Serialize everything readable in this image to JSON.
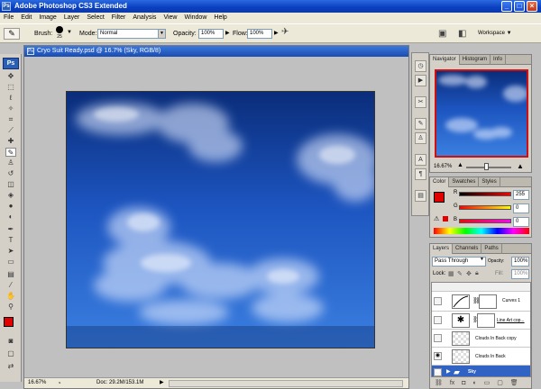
{
  "app": {
    "title": "Adobe Photoshop CS3 Extended",
    "logo": "Ps",
    "window_controls": {
      "minimize": "_",
      "maximize": "□",
      "close": "×"
    }
  },
  "menu": [
    "File",
    "Edit",
    "Image",
    "Layer",
    "Select",
    "Filter",
    "Analysis",
    "View",
    "Window",
    "Help"
  ],
  "options_bar": {
    "brush_label": "Brush:",
    "brush_size": "25",
    "mode_label": "Mode:",
    "mode_value": "Normal",
    "opacity_label": "Opacity:",
    "opacity_value": "100%",
    "flow_label": "Flow:",
    "flow_value": "100%",
    "workspace_label": "Workspace ▼"
  },
  "document": {
    "title": "Cryo Suit Ready.psd @ 16.7% (Sky, RGB/8)",
    "zoom": "16.67%",
    "doc_info": "Doc: 29.2M/153.1M"
  },
  "navigator": {
    "tabs": [
      "Navigator",
      "Histogram",
      "Info"
    ],
    "zoom": "16.67%"
  },
  "color_panel": {
    "tabs": [
      "Color",
      "Swatches",
      "Styles"
    ],
    "fg_color": "#e00000",
    "bg_color": "#000000",
    "channels": [
      {
        "label": "R",
        "value": "255"
      },
      {
        "label": "G",
        "value": "0"
      },
      {
        "label": "B",
        "value": "0"
      }
    ]
  },
  "layers_panel": {
    "tabs": [
      "Layers",
      "Channels",
      "Paths"
    ],
    "blend_mode": "Pass Through",
    "opacity_label": "Opacity:",
    "opacity_value": "100%",
    "lock_label": "Lock:",
    "fill_label": "Fill:",
    "fill_value": "100%",
    "layers": [
      {
        "name": "Curves 1",
        "visible": false,
        "kind": "adjustment"
      },
      {
        "name": "Line Art cop...",
        "visible": false,
        "kind": "lineart"
      },
      {
        "name": "Clouds In Back copy",
        "visible": false,
        "kind": "layer"
      },
      {
        "name": "Clouds In Back",
        "visible": true,
        "kind": "layer"
      },
      {
        "name": "Sky",
        "visible": true,
        "kind": "group",
        "selected": true
      }
    ]
  },
  "colors": {
    "accent": "#0a3fc0",
    "selected_layer": "#3163c5",
    "sky_top": "#0a2d7a",
    "sky_bottom": "#3b7fe0"
  }
}
